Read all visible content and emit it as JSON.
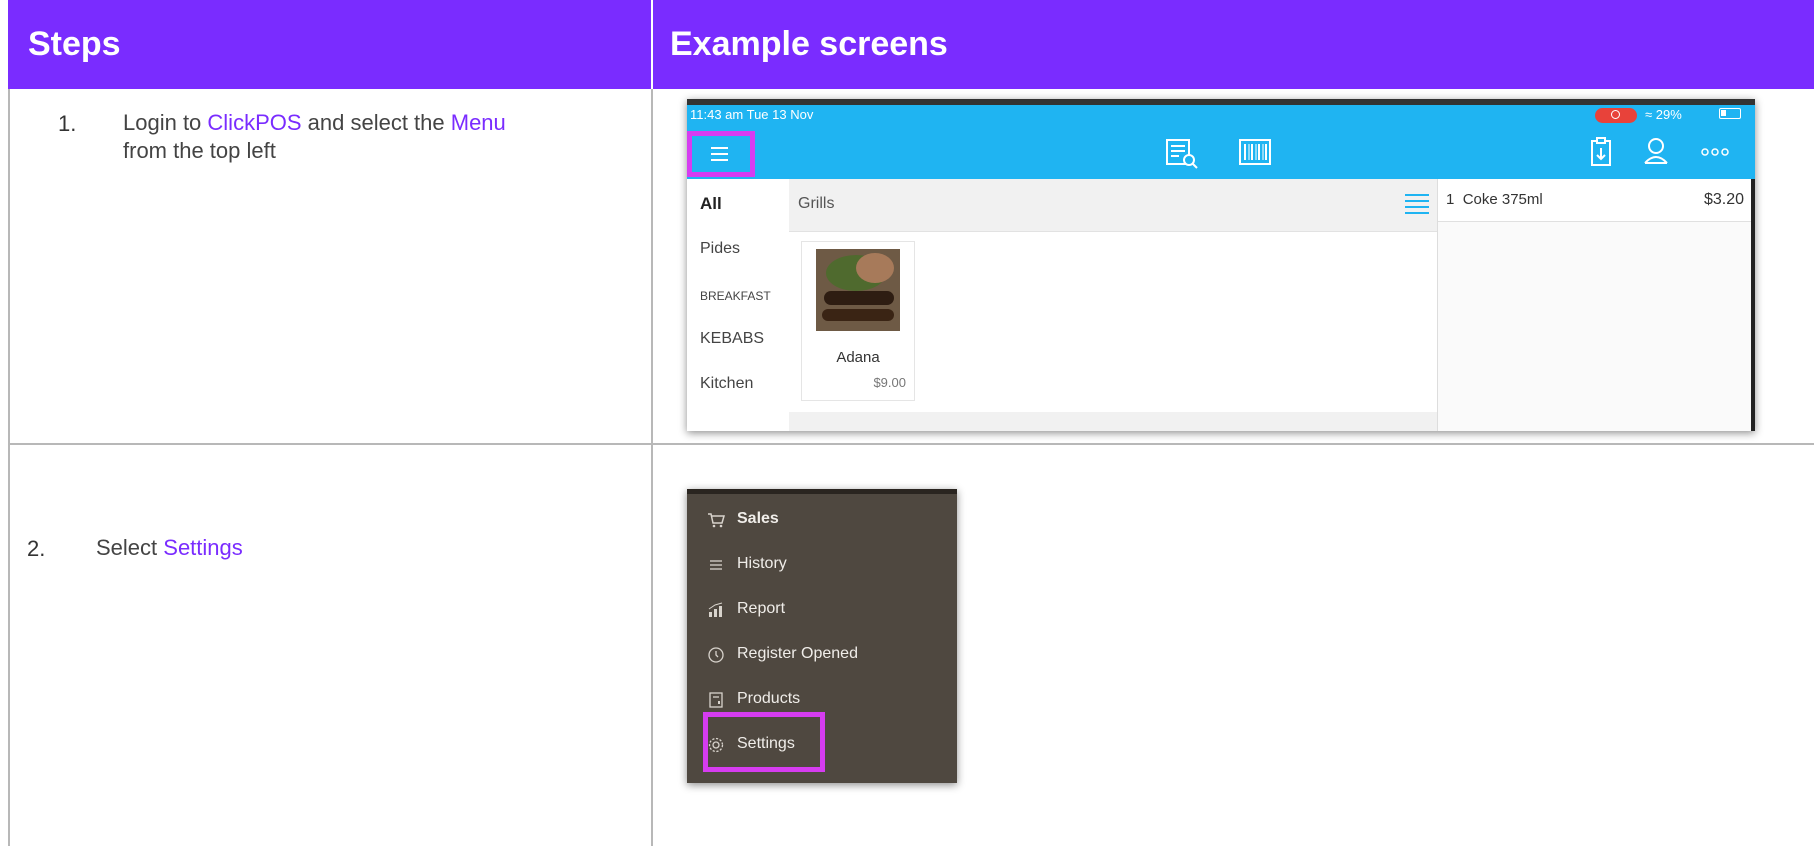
{
  "header": {
    "steps_title": "Steps",
    "screens_title": "Example screens"
  },
  "steps": [
    {
      "number": "1.",
      "text_before": "Login to ",
      "link1": "ClickPOS",
      "text_mid": " and select the ",
      "link2": "Menu",
      "text_after": " from the top left"
    },
    {
      "number": "2.",
      "text_before": "Select ",
      "link1": "Settings"
    }
  ],
  "screen1": {
    "status_time": "11:43 am  Tue 13 Nov",
    "status_battery": "29%",
    "categories": [
      "All",
      "Pides",
      "BREAKFAST",
      "KEBABS",
      "Kitchen"
    ],
    "group_title": "Grills",
    "product": {
      "name": "Adana",
      "price": "$9.00"
    },
    "cart": {
      "qty": "1",
      "item": "Coke 375ml",
      "price": "$3.20"
    },
    "icons": [
      "menu-icon",
      "search-list-icon",
      "barcode-icon",
      "clipboard-icon",
      "user-icon",
      "more-icon",
      "list-view-icon"
    ]
  },
  "screen2": {
    "menu_items": [
      {
        "label": "Sales",
        "icon": "cart-icon"
      },
      {
        "label": "History",
        "icon": "history-icon"
      },
      {
        "label": "Report",
        "icon": "chart-icon"
      },
      {
        "label": "Register Opened",
        "icon": "clock-icon"
      },
      {
        "label": "Products",
        "icon": "products-icon"
      },
      {
        "label": "Settings",
        "icon": "gear-icon"
      }
    ]
  },
  "colors": {
    "accent": "#7a2cff",
    "highlight_box": "#d63cf1",
    "pos_topbar": "#1fb4f2",
    "menu_bg": "#4f4840"
  }
}
